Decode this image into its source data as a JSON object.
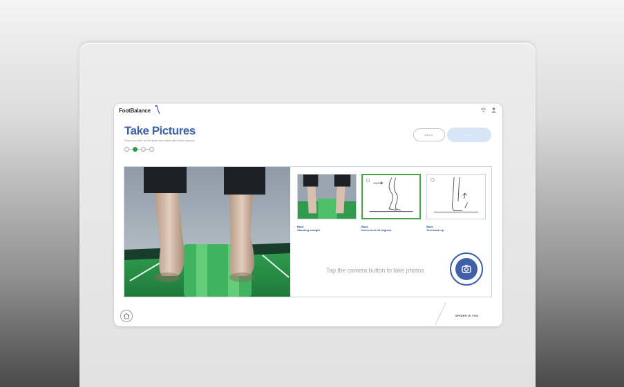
{
  "app": {
    "brand": "FootBalance",
    "footer_brand": "SPIDER IS YOU"
  },
  "header": {
    "title": "Take Pictures",
    "subtitle": "Place your feet on the plate and stand still for the camera",
    "back_label": "BACK",
    "next_label": "NEXT"
  },
  "steps": {
    "total": 4,
    "active_index": 1
  },
  "thumbnails": [
    {
      "label_line1": "Back",
      "label_line2": "Standing straight",
      "active": false,
      "icon": "feet-photo"
    },
    {
      "label_line1": "Back",
      "label_line2": "Knees bent 45 degrees",
      "active": true,
      "icon": "knee-bend-icon"
    },
    {
      "label_line1": "Back",
      "label_line2": "Toes back up",
      "active": false,
      "icon": "toes-up-icon"
    }
  ],
  "instruction": "Tap the camera button to take photos",
  "colors": {
    "accent_blue": "#3f5fa8",
    "active_green": "#44a547",
    "plate_green": "#2e9b4e"
  },
  "icons": {
    "capture": "camera-capture-icon",
    "home": "home-icon",
    "wifi": "wifi-icon",
    "user": "user-icon"
  }
}
